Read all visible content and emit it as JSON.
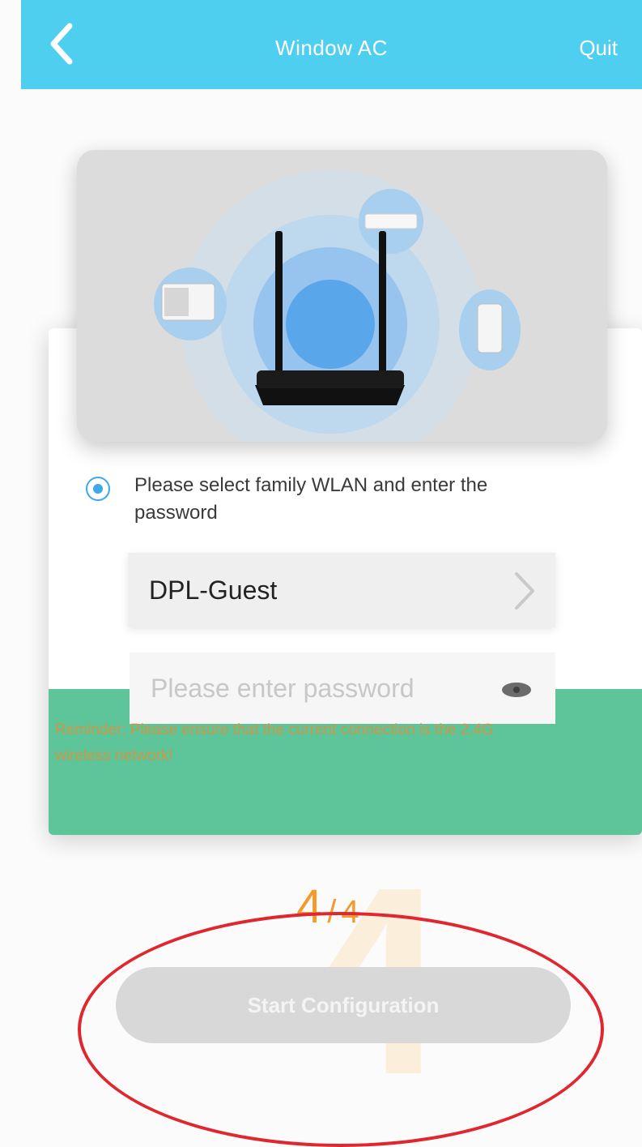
{
  "header": {
    "title": "Window AC",
    "quit_label": "Quit",
    "back_icon": "chevron-left-icon"
  },
  "illustration": {
    "devices": [
      "window-ac-icon",
      "split-ac-icon",
      "portable-ac-icon",
      "router-icon"
    ]
  },
  "wlan": {
    "instruction": "Please select family WLAN and enter the password",
    "selected_network": "DPL-Guest",
    "password_placeholder": "Please enter password",
    "password_value": ""
  },
  "reminder": "Reminder: Please ensure that the current connection is the 2.4G wireless network!",
  "step": {
    "current": "4",
    "separator": "/",
    "total": "4"
  },
  "actions": {
    "start_label": "Start Configuration"
  },
  "colors": {
    "header": "#4ecff0",
    "accent_green": "#5ec49a",
    "step_orange": "#f39a2b",
    "highlight_red": "#e0262e"
  }
}
